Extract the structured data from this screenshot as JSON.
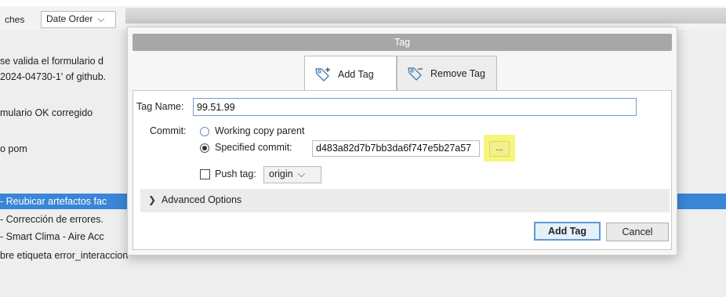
{
  "background": {
    "toolbar": {
      "branches_fragment": "ches",
      "order_select": "Date Order"
    },
    "lines": [
      "se valida el formulario d",
      "2024-04730-1' of github.",
      "mulario OK corregido",
      "o pom",
      "- Reubicar artefactos fac",
      "- Corrección de errores.",
      "- Smart Clima - Aire Acc",
      "bre etiqueta error_interaccion"
    ],
    "selected_line_index": 4
  },
  "dialog": {
    "title": "Tag",
    "tabs": [
      {
        "label": "Add Tag",
        "icon": "tag-add-icon",
        "active": true
      },
      {
        "label": "Remove Tag",
        "icon": "tag-remove-icon",
        "active": false
      }
    ],
    "tag_name_label": "Tag Name:",
    "tag_name_value": "99.51.99",
    "commit_label": "Commit:",
    "working_copy_label": "Working copy parent",
    "specified_commit_label": "Specified commit:",
    "selected_commit_option": "specified",
    "commit_hash": "d483a82d7b7bb3da6f747e5b27a57",
    "browse_label": "...",
    "push_tag_label": "Push tag:",
    "push_tag_checked": false,
    "remote_value": "origin",
    "advanced_label": "Advanced Options",
    "add_button_label": "Add Tag",
    "cancel_button_label": "Cancel",
    "colors": {
      "title_bar": "#a7a7a7",
      "selection": "#3a86d6",
      "highlight": "#f7f57a",
      "default_button_border": "#5e9ad6"
    }
  }
}
